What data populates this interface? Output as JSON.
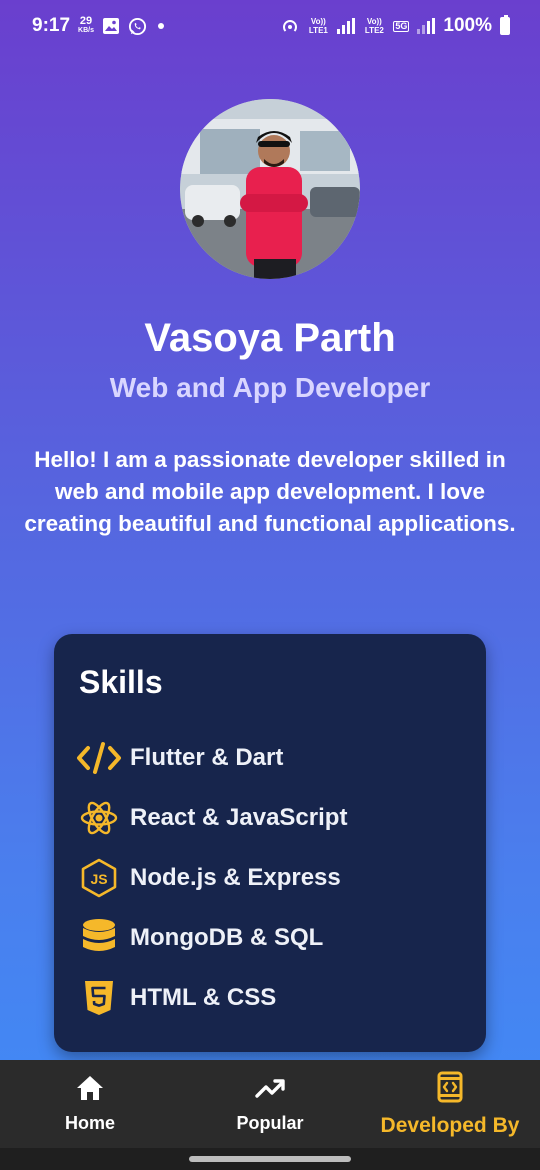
{
  "status_bar": {
    "time": "9:17",
    "net_speed_value": "29",
    "net_speed_unit": "KB/s",
    "sim1_label": "Vo)) LTE1",
    "sim2_label": "Vo)) LTE2",
    "network_type": "5G",
    "battery": "100%"
  },
  "profile": {
    "name": "Vasoya Parth",
    "role": "Web and App Developer",
    "bio": "Hello! I am a passionate developer skilled in web and mobile app development. I love creating beautiful and functional applications."
  },
  "skills": {
    "title": "Skills",
    "items": [
      {
        "label": "Flutter & Dart",
        "icon": "code-icon"
      },
      {
        "label": "React & JavaScript",
        "icon": "react-icon"
      },
      {
        "label": "Node.js & Express",
        "icon": "nodejs-icon"
      },
      {
        "label": "MongoDB & SQL",
        "icon": "database-icon"
      },
      {
        "label": "HTML & CSS",
        "icon": "html5-icon"
      }
    ]
  },
  "bottom_nav": {
    "items": [
      {
        "label": "Home",
        "icon": "home-icon",
        "active": false
      },
      {
        "label": "Popular",
        "icon": "trending-up-icon",
        "active": false
      },
      {
        "label": "Developed By",
        "icon": "developer-icon",
        "active": true
      }
    ]
  },
  "colors": {
    "accent": "#f5b82a",
    "card_bg": "#17254c",
    "nav_bg": "#2b2b2b",
    "gradient_top": "#6a3fce",
    "gradient_bottom": "#3f8cf7"
  }
}
